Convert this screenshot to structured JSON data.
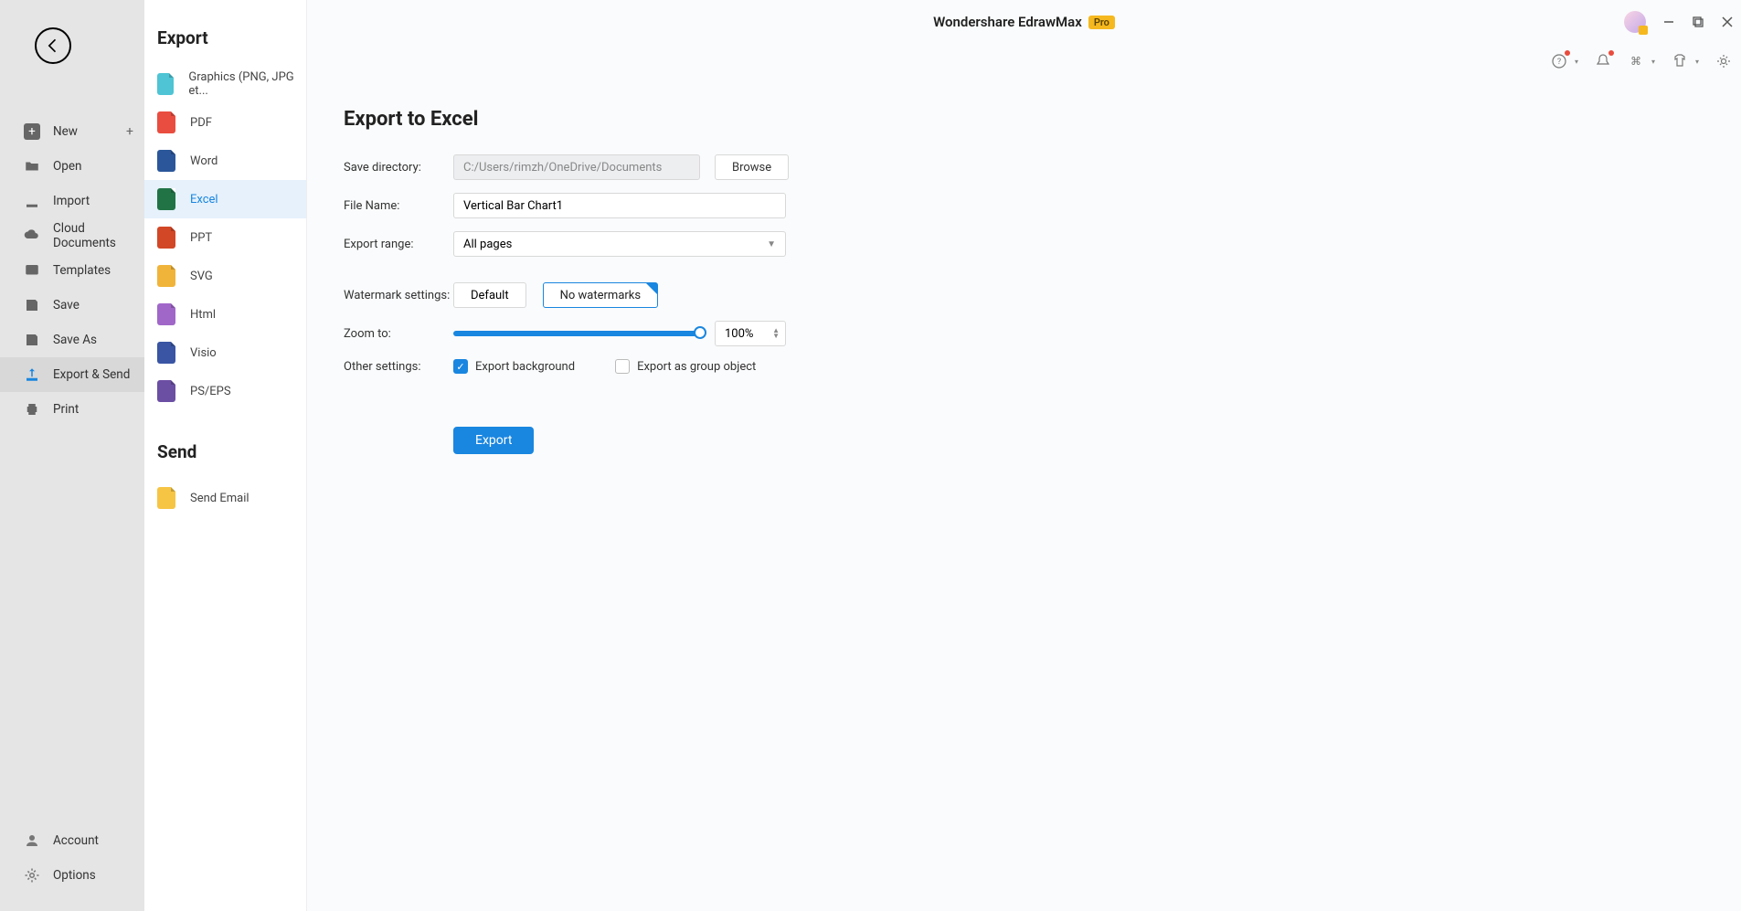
{
  "app": {
    "title": "Wondershare EdrawMax",
    "badge": "Pro"
  },
  "leftNav": {
    "new": "New",
    "open": "Open",
    "import": "Import",
    "cloud": "Cloud Documents",
    "templates": "Templates",
    "save": "Save",
    "saveAs": "Save As",
    "exportSend": "Export & Send",
    "print": "Print",
    "account": "Account",
    "options": "Options"
  },
  "secondNav": {
    "sectionExport": "Export",
    "sectionSend": "Send",
    "graphics": "Graphics (PNG, JPG et...",
    "pdf": "PDF",
    "word": "Word",
    "excel": "Excel",
    "ppt": "PPT",
    "svg": "SVG",
    "html": "Html",
    "visio": "Visio",
    "pseps": "PS/EPS",
    "sendEmail": "Send Email"
  },
  "panel": {
    "title": "Export to Excel",
    "labels": {
      "saveDir": "Save directory:",
      "fileName": "File Name:",
      "exportRange": "Export range:",
      "watermark": "Watermark settings:",
      "zoom": "Zoom to:",
      "other": "Other settings:"
    },
    "saveDirectory": "C:/Users/rimzh/OneDrive/Documents",
    "browse": "Browse",
    "fileNameValue": "Vertical Bar Chart1",
    "exportRangeValue": "All pages",
    "watermarkDefault": "Default",
    "watermarkNone": "No watermarks",
    "zoomValue": "100%",
    "exportBackground": "Export background",
    "exportGroupObject": "Export as group object",
    "exportButton": "Export"
  }
}
